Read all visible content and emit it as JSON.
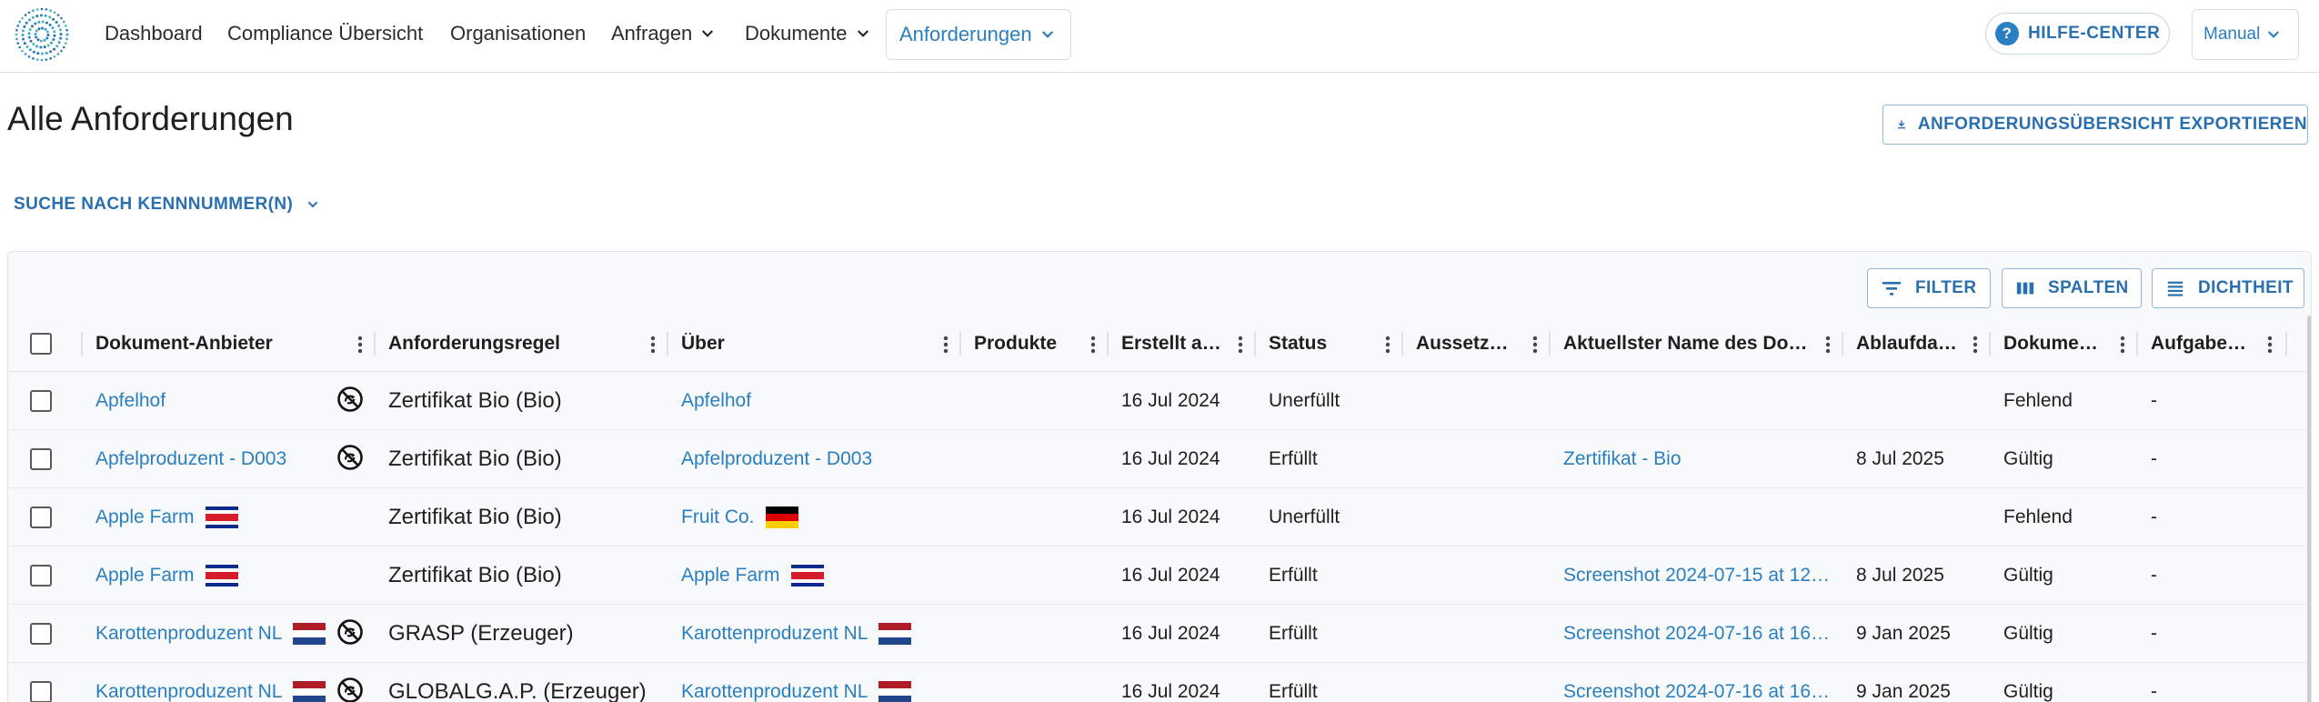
{
  "nav": {
    "items": [
      {
        "label": "Dashboard",
        "has_chevron": false
      },
      {
        "label": "Compliance Übersicht",
        "has_chevron": false
      },
      {
        "label": "Organisationen",
        "has_chevron": false
      },
      {
        "label": "Anfragen",
        "has_chevron": true
      },
      {
        "label": "Dokumente",
        "has_chevron": true
      }
    ],
    "active": {
      "label": "Anforderungen"
    },
    "help_label": "HILFE-CENTER",
    "help_icon_text": "?",
    "manual_label": "Manual"
  },
  "page": {
    "title": "Alle Anforderungen",
    "export_label": "ANFORDERUNGSÜBERSICHT EXPORTIEREN",
    "search_label": "SUCHE NACH KENNNUMMER(N)"
  },
  "toolbar": {
    "filter_label": "FILTER",
    "columns_label": "SPALTEN",
    "density_label": "DICHTHEIT"
  },
  "table": {
    "columns": [
      "Dokument-Anbieter",
      "Anforderungsregel",
      "Über",
      "Produkte",
      "Erstellt a…",
      "Status",
      "Aussetz…",
      "Aktuellster Name des Dok…",
      "Ablaufda…",
      "Dokume…",
      "Aufgabe…"
    ],
    "rows": [
      {
        "provider": "Apfelhof",
        "provider_flag": "",
        "provider_no_icon": true,
        "rule": "Zertifikat Bio (Bio)",
        "about": "Apfelhof",
        "about_flag": "",
        "products": "",
        "created": "16 Jul 2024",
        "status": "Unerfüllt",
        "suspended": "",
        "docname": "",
        "expiry": "",
        "docstatus": "Fehlend",
        "task": "-"
      },
      {
        "provider": "Apfelproduzent - D003",
        "provider_flag": "",
        "provider_no_icon": true,
        "rule": "Zertifikat Bio (Bio)",
        "about": "Apfelproduzent - D003",
        "about_flag": "",
        "products": "",
        "created": "16 Jul 2024",
        "status": "Erfüllt",
        "suspended": "",
        "docname": "Zertifikat - Bio",
        "expiry": "8 Jul 2025",
        "docstatus": "Gültig",
        "task": "-"
      },
      {
        "provider": "Apple Farm",
        "provider_flag": "cr",
        "provider_no_icon": false,
        "rule": "Zertifikat Bio (Bio)",
        "about": "Fruit Co.",
        "about_flag": "de",
        "products": "",
        "created": "16 Jul 2024",
        "status": "Unerfüllt",
        "suspended": "",
        "docname": "",
        "expiry": "",
        "docstatus": "Fehlend",
        "task": "-"
      },
      {
        "provider": "Apple Farm",
        "provider_flag": "cr",
        "provider_no_icon": false,
        "rule": "Zertifikat Bio (Bio)",
        "about": "Apple Farm",
        "about_flag": "cr",
        "products": "",
        "created": "16 Jul 2024",
        "status": "Erfüllt",
        "suspended": "",
        "docname": "Screenshot 2024-07-15 at 12.…",
        "expiry": "8 Jul 2025",
        "docstatus": "Gültig",
        "task": "-"
      },
      {
        "provider": "Karottenproduzent NL",
        "provider_flag": "nl",
        "provider_no_icon": true,
        "rule": "GRASP (Erzeuger)",
        "about": "Karottenproduzent NL",
        "about_flag": "nl",
        "products": "",
        "created": "16 Jul 2024",
        "status": "Erfüllt",
        "suspended": "",
        "docname": "Screenshot 2024-07-16 at 16.…",
        "expiry": "9 Jan 2025",
        "docstatus": "Gültig",
        "task": "-"
      },
      {
        "provider": "Karottenproduzent NL",
        "provider_flag": "nl",
        "provider_no_icon": true,
        "rule": "GLOBALG.A.P. (Erzeuger)",
        "about": "Karottenproduzent NL",
        "about_flag": "nl",
        "products": "",
        "created": "16 Jul 2024",
        "status": "Erfüllt",
        "suspended": "",
        "docname": "Screenshot 2024-07-16 at 16.…",
        "expiry": "9 Jan 2025",
        "docstatus": "Gültig",
        "task": "-"
      }
    ]
  },
  "colors": {
    "accent": "#2a7fc0",
    "flag_cr": [
      "#0b2b8f",
      "#ffffff",
      "#d61c2a"
    ],
    "flag_de": [
      "#000000",
      "#dd0000",
      "#ffce00"
    ],
    "flag_nl": [
      "#ae1c28",
      "#ffffff",
      "#21468b"
    ]
  }
}
